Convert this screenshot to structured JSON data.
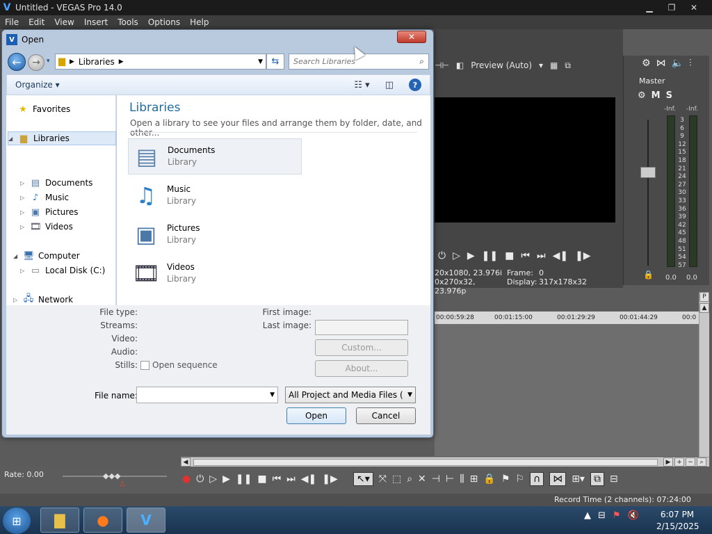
{
  "app": {
    "title": "Untitled - VEGAS Pro 14.0",
    "menu": [
      "File",
      "Edit",
      "View",
      "Insert",
      "Tools",
      "Options",
      "Help"
    ],
    "preview_mode": "Preview (Auto)",
    "preview_info": {
      "project": "20x1080, 23.976i",
      "preview": "0x270x32, 23.976p",
      "frame_label": "Frame:",
      "frame_value": "0",
      "display_label": "Display:",
      "display_value": "317x178x32"
    },
    "mixer": {
      "master_label": "Master",
      "m": "M",
      "s": "S",
      "inf_left": "-Inf.",
      "inf_right": "-Inf.",
      "scale": [
        "3",
        "6",
        "9",
        "12",
        "15",
        "18",
        "21",
        "24",
        "27",
        "30",
        "33",
        "36",
        "39",
        "42",
        "45",
        "48",
        "51",
        "54",
        "57"
      ],
      "zero_left": "0.0",
      "zero_right": "0.0"
    },
    "timeline_marks": [
      "00:00:59:28",
      "00:01:15:00",
      "00:01:29:29",
      "00:01:44:29",
      "00:0"
    ],
    "rate": "Rate: 0.00",
    "record_time": "Record Time (2 channels): 07:24:00"
  },
  "dialog": {
    "title": "Open",
    "close": "✕",
    "address": {
      "crumb": "Libraries"
    },
    "search_placeholder": "Search Libraries",
    "organize": "Organize",
    "nav": {
      "favorites": "Favorites",
      "libraries": "Libraries",
      "documents": "Documents",
      "music": "Music",
      "pictures": "Pictures",
      "videos": "Videos",
      "computer": "Computer",
      "local_disk": "Local Disk (C:)",
      "network": "Network"
    },
    "content": {
      "heading": "Libraries",
      "subtitle": "Open a library to see your files and arrange them by folder, date, and other...",
      "items": [
        {
          "name": "Documents",
          "type": "Library"
        },
        {
          "name": "Music",
          "type": "Library"
        },
        {
          "name": "Pictures",
          "type": "Library"
        },
        {
          "name": "Videos",
          "type": "Library"
        }
      ]
    },
    "details": {
      "file_type": "File type:",
      "streams": "Streams:",
      "video": "Video:",
      "audio": "Audio:",
      "stills": "Stills:",
      "open_sequence": "Open sequence",
      "first_image": "First image:",
      "last_image": "Last image:",
      "custom": "Custom...",
      "about": "About..."
    },
    "file_name_label": "File name:",
    "file_name_value": "",
    "file_type_value": "All Project and Media Files (*.ve",
    "open_button": "Open",
    "cancel_button": "Cancel"
  },
  "taskbar": {
    "time": "6:07 PM",
    "date": "2/15/2025"
  }
}
